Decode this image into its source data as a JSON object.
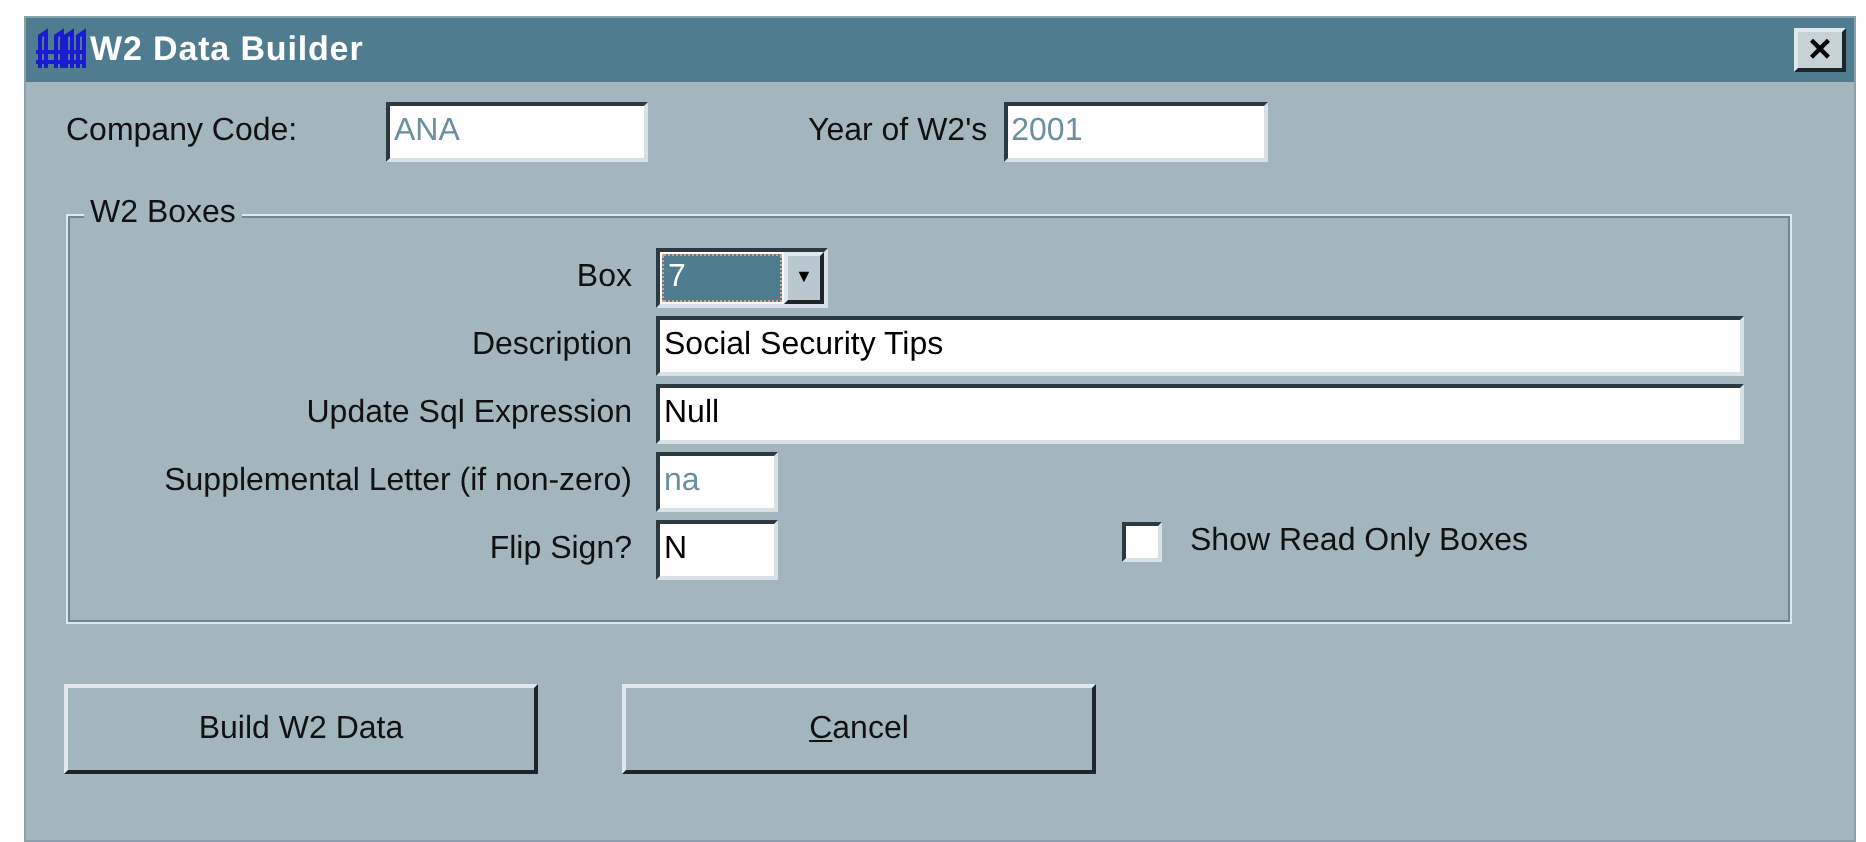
{
  "window": {
    "title": "W2 Data Builder",
    "close": "×"
  },
  "header_fields": [
    {
      "label": "Company Code:",
      "value": "ANA",
      "disabled": true
    },
    {
      "label": "Year of W2's",
      "value": "2001",
      "disabled": true
    }
  ],
  "group": {
    "title": "W2 Boxes",
    "box": {
      "label": "Box",
      "value": "7",
      "arrow": "▼"
    },
    "fields": [
      {
        "label": "Description",
        "value": "Social Security Tips",
        "disabled": false,
        "kind": "wide"
      },
      {
        "label": "Update Sql Expression",
        "value": "Null",
        "disabled": false,
        "kind": "wide"
      },
      {
        "label": "Supplemental Letter (if non-zero)",
        "value": "na",
        "disabled": true,
        "kind": "short"
      },
      {
        "label": "Flip Sign?",
        "value": "N",
        "disabled": false,
        "kind": "short"
      }
    ],
    "checkbox": {
      "label": "Show Read Only Boxes",
      "checked": false
    }
  },
  "buttons": [
    {
      "label": "Build W2 Data",
      "underline_first": false
    },
    {
      "label": "Cancel",
      "underline_first": true
    }
  ]
}
